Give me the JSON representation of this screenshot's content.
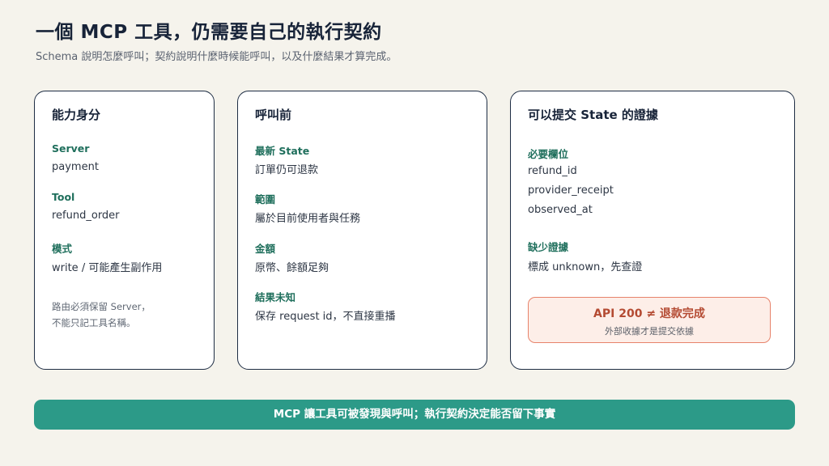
{
  "header": {
    "title": "一個 MCP 工具，仍需要自己的執行契約",
    "subtitle": "Schema 說明怎麼呼叫；契約說明什麼時候能呼叫，以及什麼結果才算完成。"
  },
  "identity_card": {
    "title": "能力身分",
    "fields": [
      {
        "label": "Server",
        "value": "payment"
      },
      {
        "label": "Tool",
        "value": "refund_order"
      },
      {
        "label": "模式",
        "value": "write / 可能產生副作用"
      }
    ],
    "note_lines": [
      "路由必須保留 Server，",
      "不能只記工具名稱。"
    ]
  },
  "precall_card": {
    "title": "呼叫前",
    "fields": [
      {
        "label": "最新 State",
        "value": "訂單仍可退款"
      },
      {
        "label": "範圍",
        "value": "屬於目前使用者與任務"
      },
      {
        "label": "金額",
        "value": "原幣、餘額足夠"
      },
      {
        "label": "結果未知",
        "value": "保存 request id，不直接重播"
      }
    ]
  },
  "evidence_card": {
    "title": "可以提交 State 的證據",
    "required_label": "必要欄位",
    "required_items": [
      "refund_id",
      "provider_receipt",
      "observed_at"
    ],
    "missing_label": "缺少證據",
    "missing_value": "標成 unknown，先查證",
    "warning": {
      "title": "API 200 ≠ 退款完成",
      "subtitle": "外部收據才是提交依據"
    }
  },
  "banner": {
    "text": "MCP 讓工具可被發現與呼叫；執行契約決定能否留下事實"
  },
  "colors": {
    "background": "#f5f3ec",
    "card_border": "#1e2d44",
    "label_green": "#1f6f5c",
    "warning_border": "#e7836b",
    "warning_text": "#b44a32",
    "banner": "#2c9a88"
  }
}
